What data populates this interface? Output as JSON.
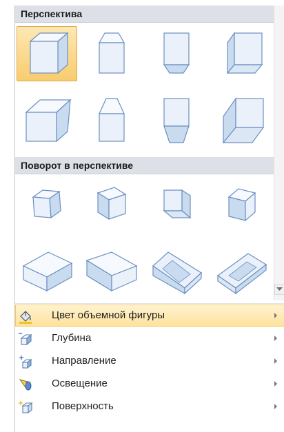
{
  "sections": {
    "perspective_title": "Перспектива",
    "rotation_title": "Поворот в перспективе"
  },
  "menu": {
    "items": [
      {
        "label": "Цвет объемной фигуры",
        "icon": "paint-bucket-icon"
      },
      {
        "label": "Глубина",
        "icon": "depth-icon"
      },
      {
        "label": "Направление",
        "icon": "direction-icon"
      },
      {
        "label": "Освещение",
        "icon": "lighting-icon"
      },
      {
        "label": "Поверхность",
        "icon": "surface-icon"
      }
    ]
  },
  "colors": {
    "shape_fill": "#eaf1fa",
    "shape_shade": "#c9dbef",
    "shape_stroke": "#6b8fc2",
    "selected_bg": "#f9cc6e",
    "highlight_bg": "#fde39e"
  }
}
